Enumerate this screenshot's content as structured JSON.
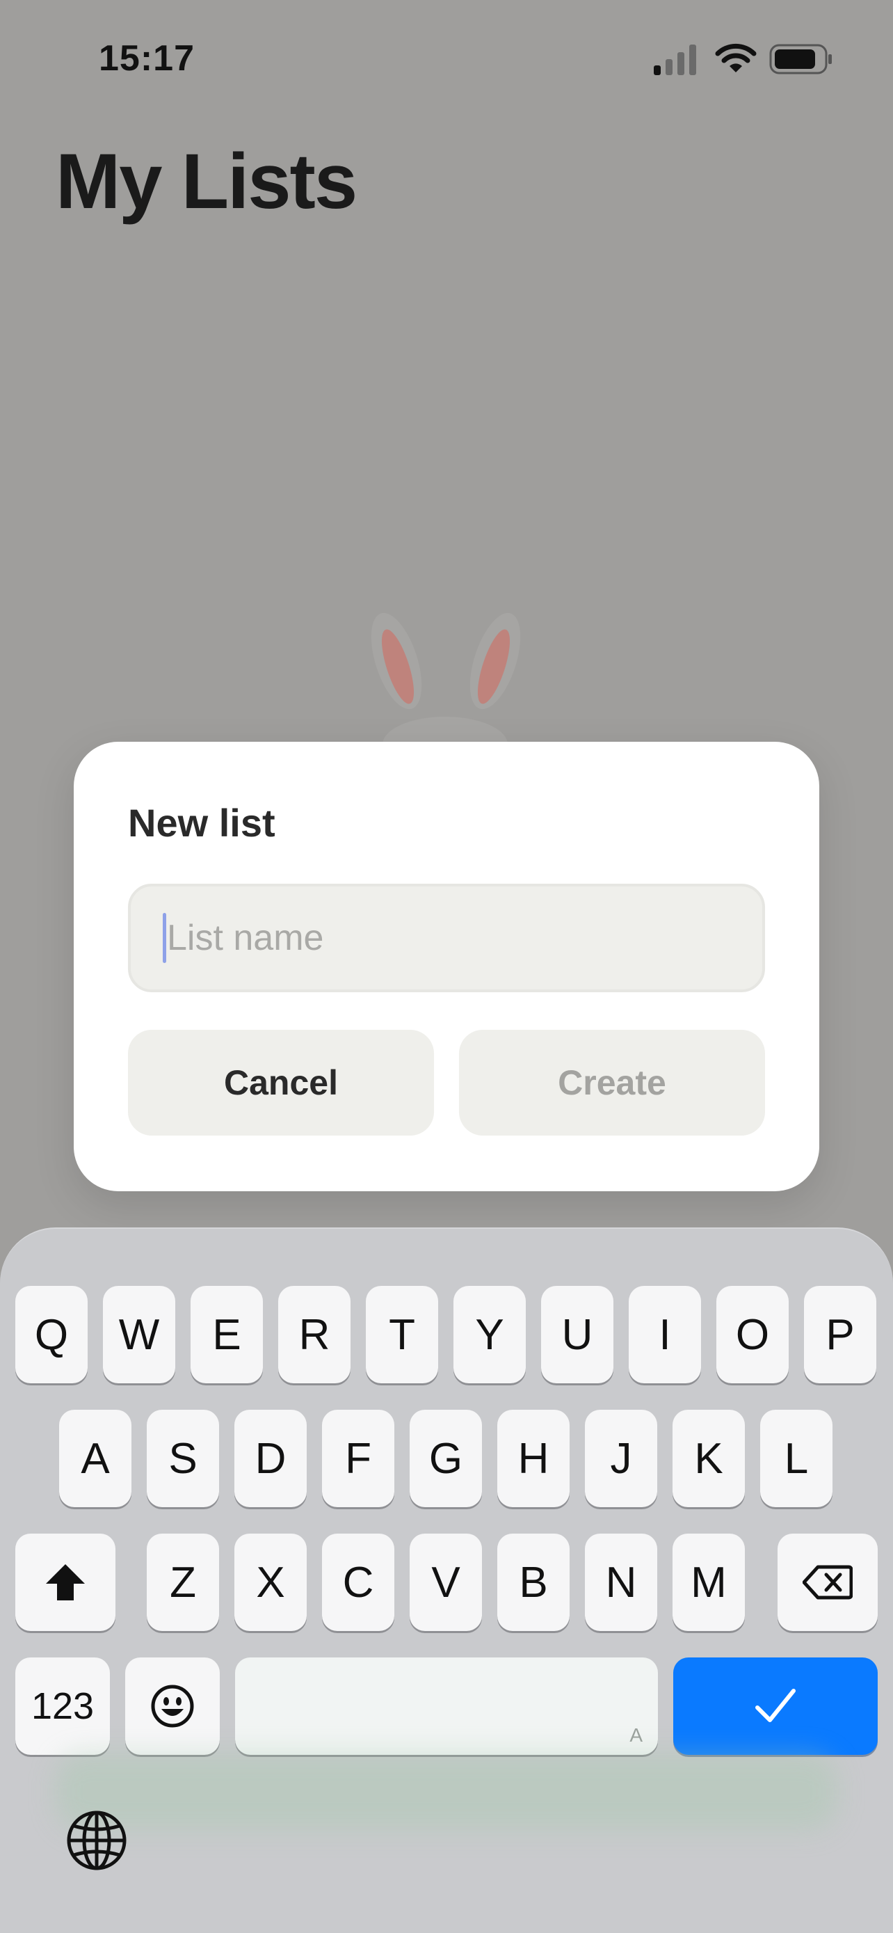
{
  "status_bar": {
    "time": "15:17"
  },
  "page": {
    "title": "My Lists"
  },
  "dialog": {
    "title": "New list",
    "input_placeholder": "List name",
    "input_value": "",
    "cancel_label": "Cancel",
    "create_label": "Create"
  },
  "keyboard": {
    "row1": [
      "Q",
      "W",
      "E",
      "R",
      "T",
      "Y",
      "U",
      "I",
      "O",
      "P"
    ],
    "row2": [
      "A",
      "S",
      "D",
      "F",
      "G",
      "H",
      "J",
      "K",
      "L"
    ],
    "row3": [
      "Z",
      "X",
      "C",
      "V",
      "B",
      "N",
      "M"
    ],
    "numbers_label": "123",
    "space_glyph": "A",
    "icons": [
      "shift-icon",
      "backspace-icon",
      "emoji-icon",
      "checkmark-icon",
      "globe-icon"
    ]
  },
  "colors": {
    "accent": "#0a7aff",
    "dim_background": "#9f9e9c",
    "dialog": "#ffffff"
  }
}
